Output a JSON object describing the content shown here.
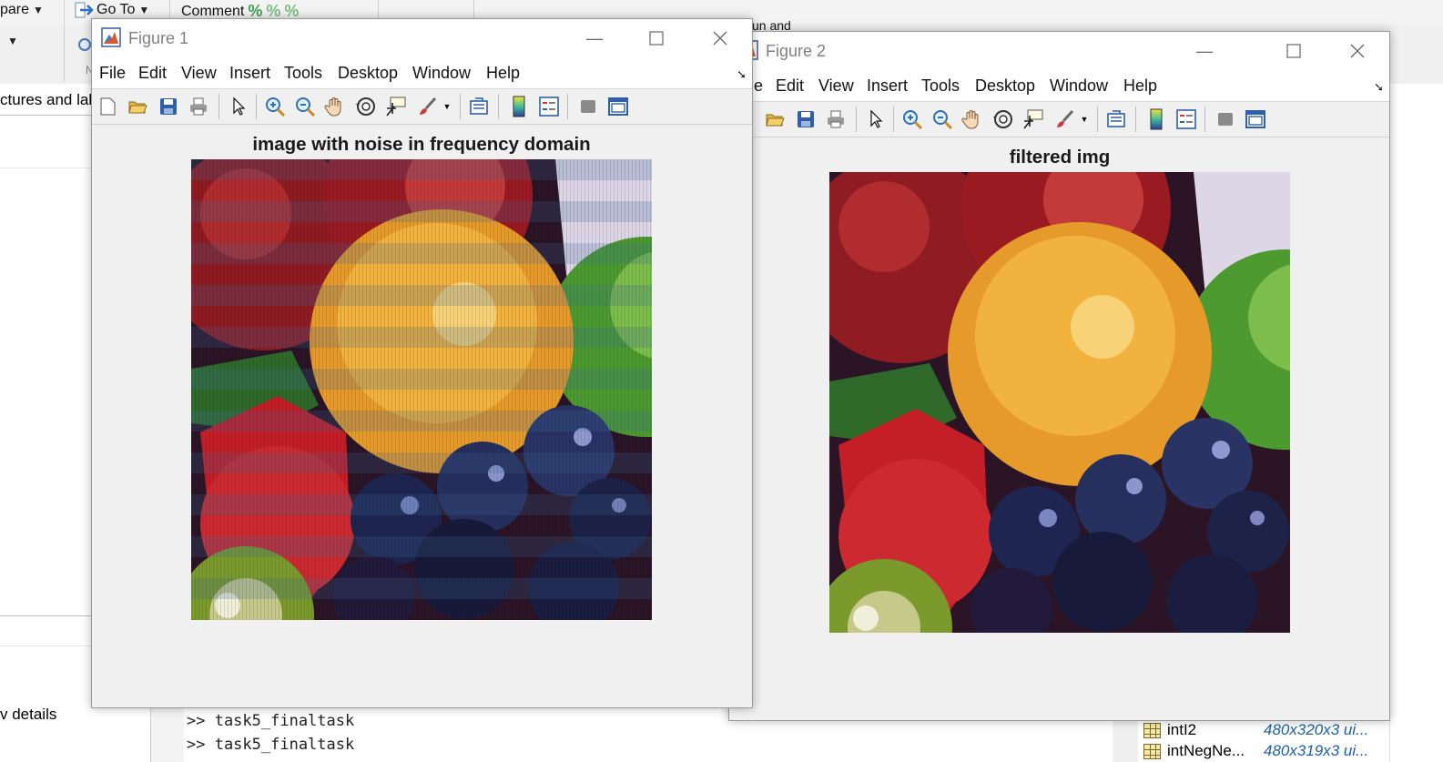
{
  "ribbon": {
    "compare_label": "pare",
    "goto_label": "Go To",
    "comment_label": "Comment",
    "run_partial": "un and",
    "section_partial": "N"
  },
  "desktop": {
    "tab_partial": "ctures and lab",
    "details_partial": "v details",
    "command_window": {
      "lines": [
        ">> task5_finaltask",
        ">> task5_finaltask"
      ]
    },
    "workspace": {
      "rows": [
        {
          "name": "intI2",
          "value": "480x320x3 ui..."
        },
        {
          "name": "intNegNe...",
          "value": "480x319x3 ui..."
        }
      ]
    }
  },
  "figures": [
    {
      "window_title": "Figure 1",
      "menu": [
        "File",
        "Edit",
        "View",
        "Insert",
        "Tools",
        "Desktop",
        "Window",
        "Help"
      ],
      "plot_title": "image with noise in frequency domain",
      "image_desc": "fruit photo with horizontal frequency-noise banding"
    },
    {
      "window_title": "Figure 2",
      "menu": [
        "File",
        "Edit",
        "View",
        "Insert",
        "Tools",
        "Desktop",
        "Window",
        "Help"
      ],
      "plot_title": "filtered img",
      "image_desc": "fruit photo after filtering"
    }
  ],
  "toolbar_icons": [
    "new-figure-icon",
    "open-file-icon",
    "save-icon",
    "print-icon",
    "edit-plot-arrow-icon",
    "zoom-in-icon",
    "zoom-out-icon",
    "pan-hand-icon",
    "rotate-3d-icon",
    "data-cursor-icon",
    "brush-icon",
    "link-plot-icon",
    "colorbar-icon",
    "legend-icon",
    "hide-plot-tools-icon",
    "show-plot-tools-icon"
  ],
  "colors": {
    "window_bg": "#f0f0f0",
    "title_text_inactive": "#808080",
    "workspace_value": "#1c5fae"
  }
}
